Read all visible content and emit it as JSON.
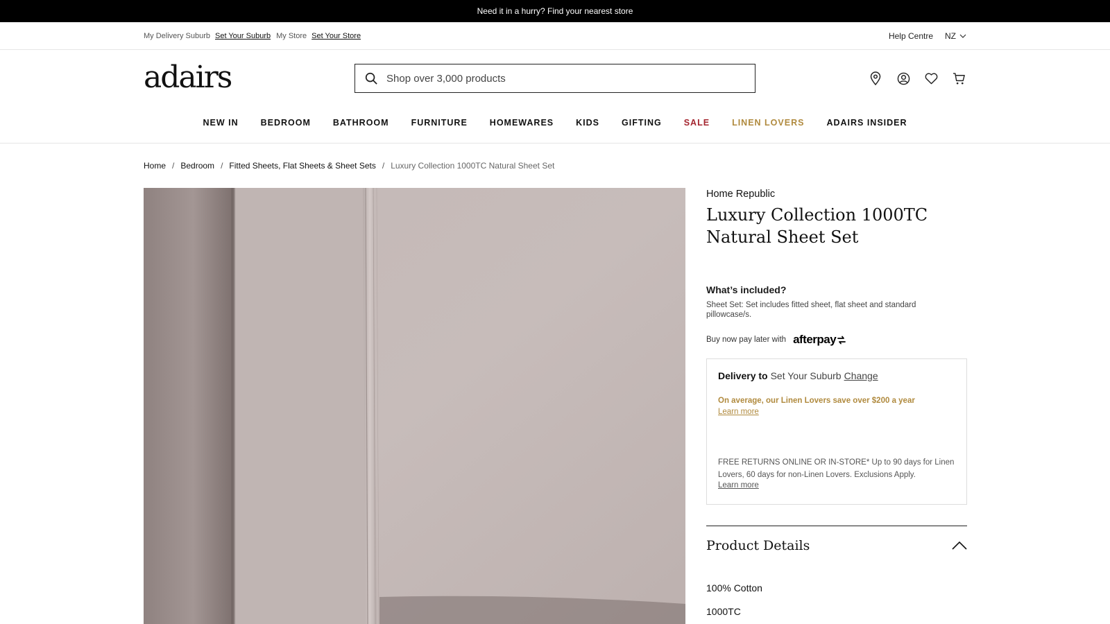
{
  "promo": {
    "text": "Need it in a hurry? Find your nearest store"
  },
  "utility": {
    "delivery_label": "My Delivery Suburb",
    "delivery_link": "Set Your Suburb",
    "store_label": "My Store",
    "store_link": "Set Your Store",
    "help": "Help Centre",
    "country": "NZ"
  },
  "header": {
    "logo": "adairs",
    "search_placeholder": "Shop over 3,000 products",
    "icons": [
      "location-pin-icon",
      "account-icon",
      "heart-icon",
      "cart-icon"
    ]
  },
  "nav": {
    "items": [
      "NEW IN",
      "BEDROOM",
      "BATHROOM",
      "FURNITURE",
      "HOMEWARES",
      "KIDS",
      "GIFTING",
      "SALE",
      "LINEN LOVERS",
      "ADAIRS INSIDER"
    ],
    "sale_color": "#a4252f",
    "linen_color": "#b08a3e"
  },
  "breadcrumb": {
    "items": [
      "Home",
      "Bedroom",
      "Fitted Sheets, Flat Sheets & Sheet Sets",
      "Luxury Collection 1000TC Natural Sheet Set"
    ],
    "separator": "/"
  },
  "product": {
    "brand": "Home Republic",
    "title_line1": "Luxury Collection 1000TC",
    "title_line2": "Natural Sheet Set",
    "included_heading": "What’s included?",
    "included_text": "Sheet Set: Set includes fitted sheet, flat sheet and standard pillowcase/s.",
    "afterpay_text": "Buy now pay later with",
    "afterpay_logo": "afterpay",
    "delivery": {
      "label": "Delivery to",
      "suburb": "Set Your Suburb",
      "change": "Change",
      "linen_save": "On average, our Linen Lovers save over $200 a year",
      "linen_more": "Learn more",
      "returns": "FREE RETURNS ONLINE OR IN-STORE* Up to 90 days for Linen Lovers, 60 days for non-Linen Lovers. Exclusions Apply.",
      "returns_more": "Learn more"
    },
    "details_heading": "Product Details",
    "specs": [
      "100% Cotton",
      "1000TC"
    ]
  }
}
